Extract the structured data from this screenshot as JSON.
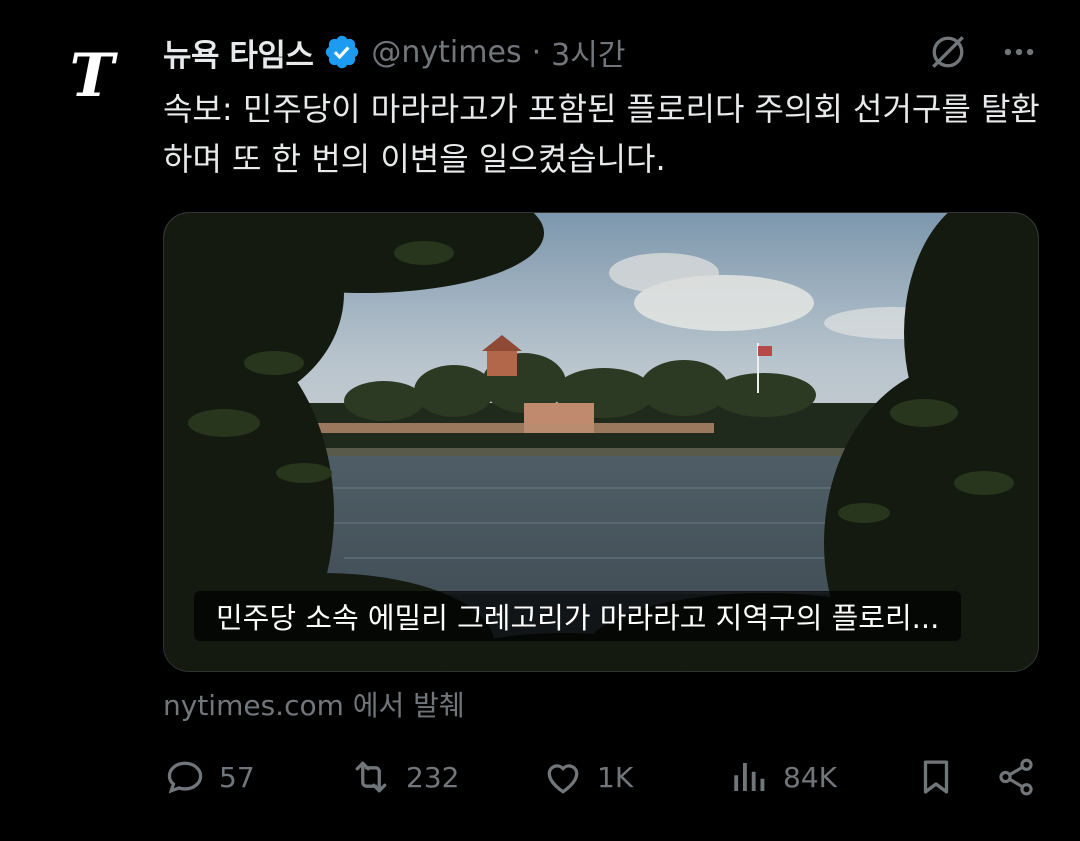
{
  "account": {
    "avatar_glyph": "T",
    "name": "뉴욕 타임스",
    "handle": "@nytimes",
    "separator": "·",
    "time": "3시간",
    "verified_color": "#1d9bf0"
  },
  "tweet": {
    "text": "속보: 민주당이 마라라고가 포함된 플로리다 주의회 선거구를 탈환하며 또 한 번의 이변을 일으켰습니다."
  },
  "media": {
    "caption": "민주당 소속 에밀리 그레고리가 마라라고 지역구의 플로리..."
  },
  "source": {
    "text": "nytimes.com 에서 발췌"
  },
  "actions": {
    "reply_count": "57",
    "retweet_count": "232",
    "like_count": "1K",
    "view_count": "84K"
  },
  "icons": {
    "grok": "grok-icon",
    "more": "more-icon",
    "reply": "reply-icon",
    "retweet": "retweet-icon",
    "like": "heart-icon",
    "views": "views-icon",
    "bookmark": "bookmark-icon",
    "share": "share-icon"
  }
}
